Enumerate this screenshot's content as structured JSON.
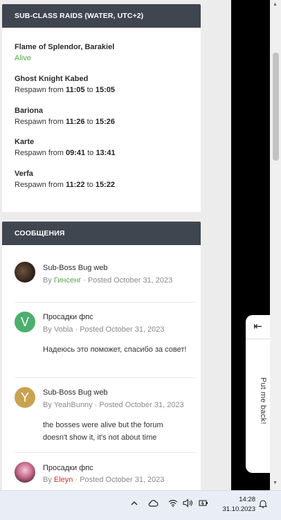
{
  "raids": {
    "title": "SUB-CLASS RAIDS (WATER, UTC+2)",
    "entries": [
      {
        "name": "Flame of Splendor, Barakiel",
        "status": "Alive"
      },
      {
        "name": "Ghost Knight Kabed",
        "prefix": "Respawn from",
        "from": "11:05",
        "to_word": "to",
        "to": "15:05"
      },
      {
        "name": "Bariona",
        "prefix": "Respawn from",
        "from": "11:26",
        "to_word": "to",
        "to": "15:26"
      },
      {
        "name": "Karte",
        "prefix": "Respawn from",
        "from": "09:41",
        "to_word": "to",
        "to": "13:41"
      },
      {
        "name": "Verfa",
        "prefix": "Respawn from",
        "from": "11:22",
        "to_word": "to",
        "to": "15:22"
      }
    ]
  },
  "messages": {
    "title": "СООБЩЕНИЯ",
    "items": [
      {
        "title": "Sub-Boss Bug web",
        "by": "By",
        "user": "Гинсенг",
        "posted": "· Posted October 31, 2023",
        "body": "",
        "avatar_letter": "",
        "avatar_color": "#3a2a1f"
      },
      {
        "title": "Просадки фпс",
        "by": "By",
        "user": "Vobla",
        "posted": "· Posted October 31, 2023",
        "body": "Надеюсь это поможет, спасибо за совет!",
        "avatar_letter": "V",
        "avatar_color": "#4caf6e"
      },
      {
        "title": "Sub-Boss Bug web",
        "by": "By",
        "user": "YeahBunny",
        "posted": "· Posted October 31, 2023",
        "body": "the bosses were alive but the forum doesn't show it, it's not about time",
        "avatar_letter": "Y",
        "avatar_color": "#c9a252"
      },
      {
        "title": "Просадки фпс",
        "by": "By",
        "user": "Eleyn",
        "posted": "· Posted October 31, 2023",
        "body": "",
        "avatar_letter": "",
        "avatar_color": "#c86a8a"
      }
    ]
  },
  "side_panel": {
    "arrow": "⇤",
    "label": "Put me back!"
  },
  "taskbar": {
    "time": "14:28",
    "date": "31.10.2023",
    "icons": [
      "chevron-up-icon",
      "cloud-icon",
      "wifi-icon",
      "speaker-icon",
      "battery-icon",
      "bell-icon"
    ]
  },
  "colors": {
    "header_bg": "#3f4650",
    "green": "#57a64a",
    "red": "#d9302a"
  }
}
